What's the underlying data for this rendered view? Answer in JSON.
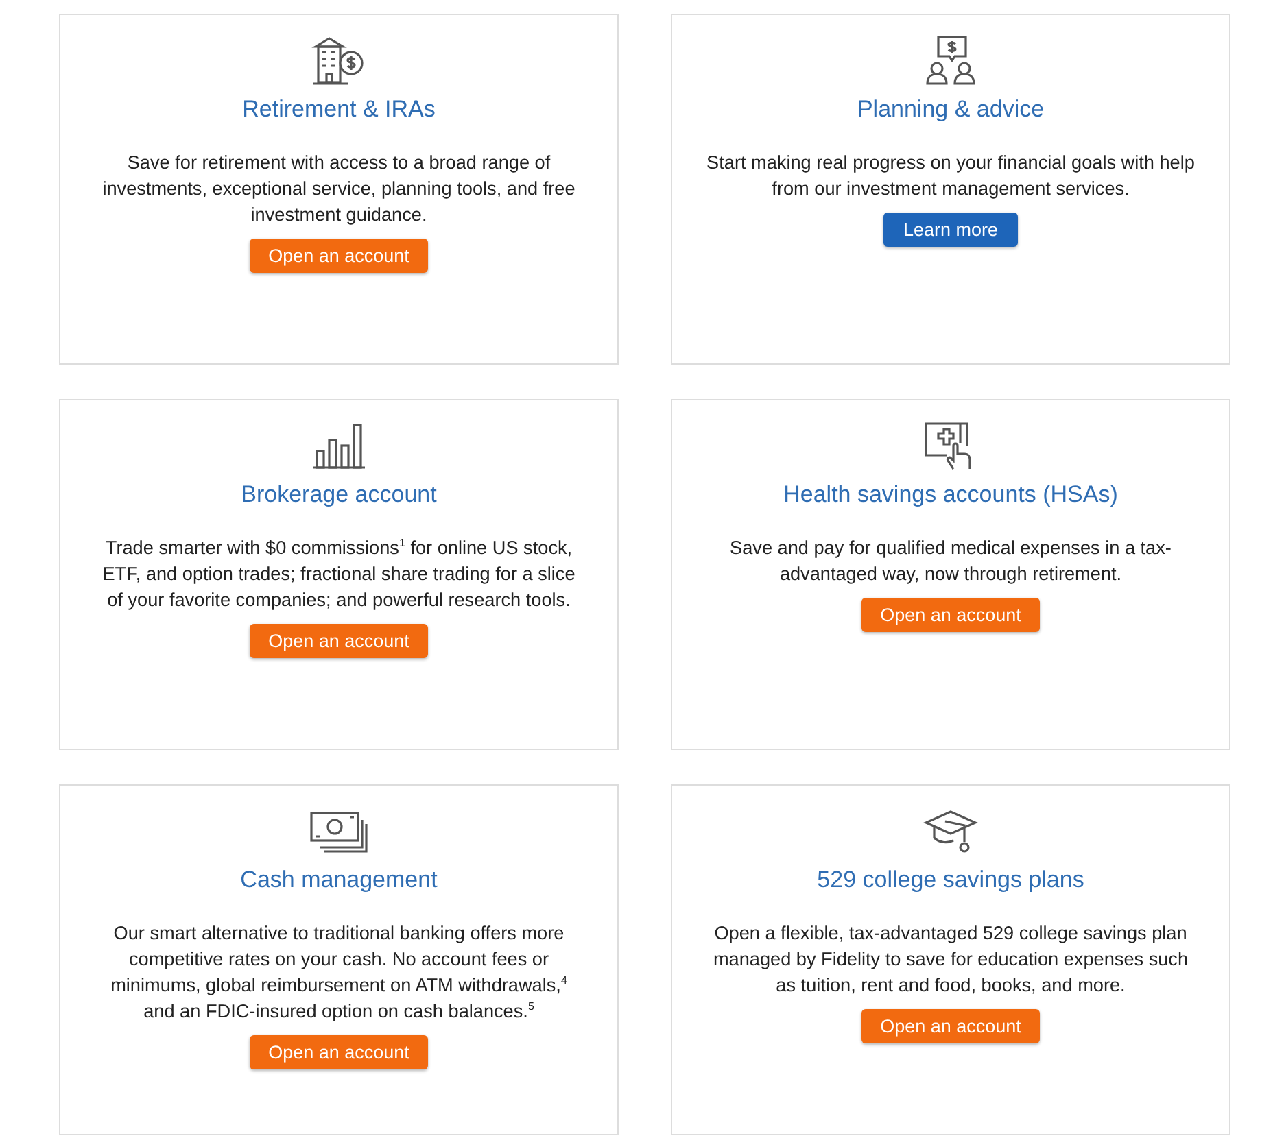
{
  "cards": [
    {
      "kind": "building",
      "title": "Retirement & IRAs",
      "description": "Save for retirement with access to a broad range of investments, exceptional service, planning tools, and free investment guidance.",
      "button": {
        "label": "Open an account",
        "kind": "primary"
      }
    },
    {
      "kind": "advisors",
      "title": "Planning & advice",
      "description": "Start making real progress on your financial goals with help from our investment management services.",
      "button": {
        "label": "Learn more",
        "kind": "secondary"
      }
    },
    {
      "kind": "bars",
      "title": "Brokerage account",
      "description": "Trade smarter with $0 commissions$^{1}$ for online US stock, ETF, and option trades; fractional share trading for a slice of your favorite companies; and powerful research tools.",
      "button": {
        "label": "Open an account",
        "kind": "primary"
      }
    },
    {
      "kind": "health",
      "title": "Health savings accounts (HSAs)",
      "description": "Save and pay for qualified medical expenses in a tax-advantaged way, now through retirement.",
      "button": {
        "label": "Open an account",
        "kind": "primary"
      }
    },
    {
      "kind": "cash",
      "title": "Cash management",
      "description": "Our smart alternative to traditional banking offers more competitive rates on your cash. No account fees or minimums, global reimbursement on ATM withdrawals,$^{4}$ and an FDIC-insured option on cash balances.$^{5}$",
      "button": {
        "label": "Open an account",
        "kind": "primary"
      }
    },
    {
      "kind": "cap",
      "title": "529 college savings plans",
      "description": "Open a flexible, tax-advantaged 529 college savings plan managed by Fidelity to save for education expenses such as tuition, rent and food, books, and more.",
      "button": {
        "label": "Open an account",
        "kind": "primary"
      }
    }
  ]
}
